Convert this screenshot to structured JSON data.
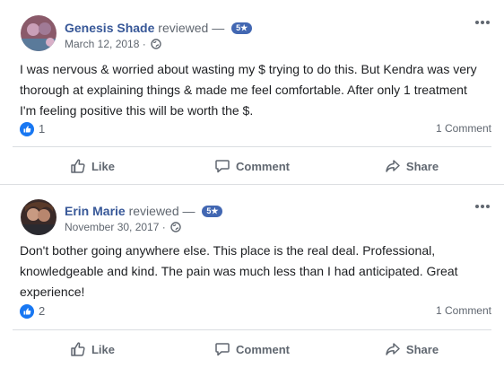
{
  "reviews": [
    {
      "author": "Genesis Shade",
      "verb": "reviewed",
      "separator": "—",
      "rating_badge": "5★",
      "date": "March 12, 2018 ·",
      "text": "I was nervous & worried about wasting my $ trying to do this. But Kendra was very thorough at explaining things & made me feel comfortable. After only 1 treatment I'm feeling positive this will be worth the $.",
      "like_count": "1",
      "comment_count": "1 Comment"
    },
    {
      "author": "Erin Marie",
      "verb": "reviewed",
      "separator": "—",
      "rating_badge": "5★",
      "date": "November 30, 2017 ·",
      "text": "Don't bother going anywhere else. This place is the real deal. Professional, knowledgeable and kind. The pain was much less than I had anticipated. Great experience!",
      "like_count": "2",
      "comment_count": "1 Comment"
    }
  ],
  "actions": {
    "like": "Like",
    "comment": "Comment",
    "share": "Share"
  },
  "colors": {
    "link_blue": "#385898",
    "badge_blue": "#4267b2",
    "secondary_text": "#606770"
  },
  "icons": [
    "globe-icon",
    "more-options-icon",
    "like-reaction-icon",
    "thumbs-up-icon",
    "comment-icon",
    "share-icon"
  ]
}
